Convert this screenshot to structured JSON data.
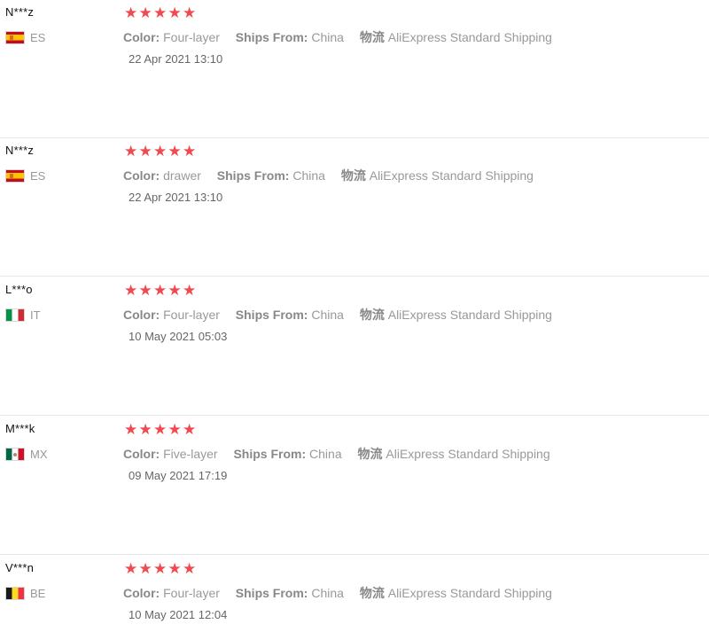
{
  "labels": {
    "color": "Color:",
    "ships_from": "Ships From:",
    "logistics": "物流"
  },
  "colors": {
    "star": "#f0494f",
    "divider": "#e8e8e8"
  },
  "reviews": [
    {
      "user": "N***z",
      "country": "ES",
      "flag_icon": "spain-flag-icon",
      "rating": 5,
      "color": "Four-layer",
      "ships_from": "China",
      "logistics": "AliExpress Standard Shipping",
      "date": "22 Apr 2021 13:10"
    },
    {
      "user": "N***z",
      "country": "ES",
      "flag_icon": "spain-flag-icon",
      "rating": 5,
      "color": "drawer",
      "ships_from": "China",
      "logistics": "AliExpress Standard Shipping",
      "date": "22 Apr 2021 13:10"
    },
    {
      "user": "L***o",
      "country": "IT",
      "flag_icon": "italy-flag-icon",
      "rating": 5,
      "color": "Four-layer",
      "ships_from": "China",
      "logistics": "AliExpress Standard Shipping",
      "date": "10 May 2021 05:03"
    },
    {
      "user": "M***k",
      "country": "MX",
      "flag_icon": "mexico-flag-icon",
      "rating": 5,
      "color": "Five-layer",
      "ships_from": "China",
      "logistics": "AliExpress Standard Shipping",
      "date": "09 May 2021 17:19"
    },
    {
      "user": "V***n",
      "country": "BE",
      "flag_icon": "belgium-flag-icon",
      "rating": 5,
      "color": "Four-layer",
      "ships_from": "China",
      "logistics": "AliExpress Standard Shipping",
      "date": "10 May 2021 12:04"
    }
  ]
}
